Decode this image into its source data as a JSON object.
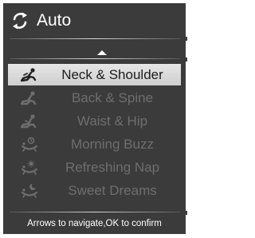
{
  "header": {
    "title": "Auto",
    "icon": "circular-arrows-icon"
  },
  "menu": {
    "items": [
      {
        "label": "Neck & Shoulder",
        "icon": "neck-shoulder-massage-icon",
        "selected": true
      },
      {
        "label": "Back & Spine",
        "icon": "back-spine-massage-icon",
        "selected": false
      },
      {
        "label": "Waist & Hip",
        "icon": "waist-hip-massage-icon",
        "selected": false
      },
      {
        "label": "Morning Buzz",
        "icon": "morning-buzz-icon",
        "selected": false
      },
      {
        "label": "Refreshing Nap",
        "icon": "refreshing-nap-icon",
        "selected": false
      },
      {
        "label": "Sweet Dreams",
        "icon": "sweet-dreams-icon",
        "selected": false
      }
    ]
  },
  "footer": {
    "hint": "Arrows to navigate,OK to confirm"
  },
  "colors": {
    "panel": "#3b3b3b",
    "selected_row": "#dcdcdc",
    "text": "#ffffff",
    "dim_text": "#6e6e6e"
  }
}
